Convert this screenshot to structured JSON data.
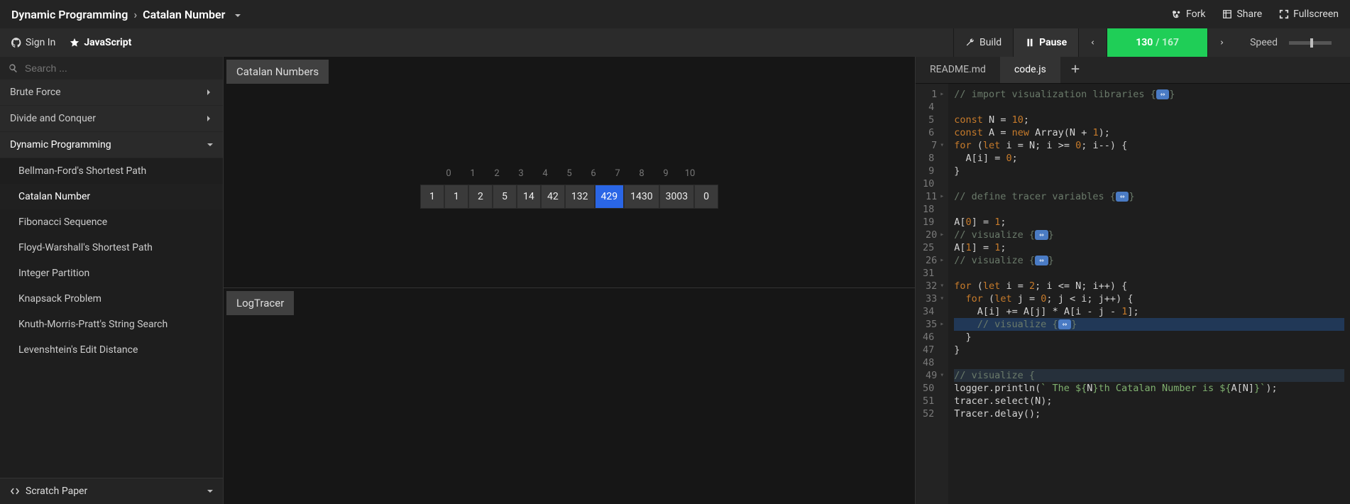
{
  "breadcrumb": {
    "category": "Dynamic Programming",
    "algo": "Catalan Number"
  },
  "topActions": {
    "fork": "Fork",
    "share": "Share",
    "fullscreen": "Fullscreen"
  },
  "auth": {
    "signIn": "Sign In",
    "lang": "JavaScript"
  },
  "controls": {
    "build": "Build",
    "pause": "Pause",
    "step": "130",
    "total": "/ 167",
    "speed": "Speed"
  },
  "search": {
    "placeholder": "Search ..."
  },
  "sidebar": {
    "categories": [
      {
        "name": "Brute Force",
        "expanded": false,
        "items": []
      },
      {
        "name": "Divide and Conquer",
        "expanded": false,
        "items": []
      },
      {
        "name": "Dynamic Programming",
        "expanded": true,
        "items": [
          "Bellman-Ford's Shortest Path",
          "Catalan Number",
          "Fibonacci Sequence",
          "Floyd-Warshall's Shortest Path",
          "Integer Partition",
          "Knapsack Problem",
          "Knuth-Morris-Pratt's String Search",
          "Levenshtein's Edit Distance"
        ],
        "activeIndex": 1
      }
    ],
    "scratch": "Scratch Paper"
  },
  "viz": {
    "title": "Catalan Numbers",
    "indices": [
      "0",
      "1",
      "2",
      "3",
      "4",
      "5",
      "6",
      "7",
      "8",
      "9",
      "10"
    ],
    "values": [
      "1",
      "1",
      "2",
      "5",
      "14",
      "42",
      "132",
      "429",
      "1430",
      "3003",
      "0"
    ],
    "selectedIndex": 7,
    "logTitle": "LogTracer"
  },
  "tabs": {
    "items": [
      "README.md",
      "code.js"
    ],
    "activeIndex": 1
  },
  "code": {
    "lines": [
      {
        "n": "1",
        "fold": "▸",
        "html": "<span class='cmt'>// import visualization libraries {</span><span class='fold-badge'>⇔</span><span class='cmt'>}</span>"
      },
      {
        "n": "4",
        "html": ""
      },
      {
        "n": "5",
        "html": "<span class='kw'>const</span> <span class='id'>N</span> <span class='op'>=</span> <span class='num'>10</span>;"
      },
      {
        "n": "6",
        "html": "<span class='kw'>const</span> <span class='id'>A</span> <span class='op'>=</span> <span class='kw'>new</span> <span class='id'>Array</span>(<span class='id'>N</span> <span class='op'>+</span> <span class='num'>1</span>);"
      },
      {
        "n": "7",
        "fold": "▾",
        "html": "<span class='kw'>for</span> (<span class='kw'>let</span> <span class='id'>i</span> <span class='op'>=</span> <span class='id'>N</span>; <span class='id'>i</span> <span class='op'>&gt;=</span> <span class='num'>0</span>; <span class='id'>i</span><span class='op'>--</span>) {"
      },
      {
        "n": "8",
        "html": "  <span class='id'>A</span>[<span class='id'>i</span>] <span class='op'>=</span> <span class='num'>0</span>;"
      },
      {
        "n": "9",
        "html": "}"
      },
      {
        "n": "10",
        "html": ""
      },
      {
        "n": "11",
        "fold": "▸",
        "html": "<span class='cmt'>// define tracer variables {</span><span class='fold-badge'>⇔</span><span class='cmt'>}</span>"
      },
      {
        "n": "18",
        "html": ""
      },
      {
        "n": "19",
        "html": "<span class='id'>A</span>[<span class='num'>0</span>] <span class='op'>=</span> <span class='num'>1</span>;"
      },
      {
        "n": "20",
        "fold": "▸",
        "html": "<span class='cmt'>// visualize {</span><span class='fold-badge'>⇔</span><span class='cmt'>}</span>"
      },
      {
        "n": "25",
        "html": "<span class='id'>A</span>[<span class='num'>1</span>] <span class='op'>=</span> <span class='num'>1</span>;"
      },
      {
        "n": "26",
        "fold": "▸",
        "html": "<span class='cmt'>// visualize {</span><span class='fold-badge'>⇔</span><span class='cmt'>}</span>"
      },
      {
        "n": "31",
        "html": ""
      },
      {
        "n": "32",
        "fold": "▾",
        "html": "<span class='kw'>for</span> (<span class='kw'>let</span> <span class='id'>i</span> <span class='op'>=</span> <span class='num'>2</span>; <span class='id'>i</span> <span class='op'>&lt;=</span> <span class='id'>N</span>; <span class='id'>i</span><span class='op'>++</span>) {"
      },
      {
        "n": "33",
        "fold": "▾",
        "html": "  <span class='kw'>for</span> (<span class='kw'>let</span> <span class='id'>j</span> <span class='op'>=</span> <span class='num'>0</span>; <span class='id'>j</span> <span class='op'>&lt;</span> <span class='id'>i</span>; <span class='id'>j</span><span class='op'>++</span>) {"
      },
      {
        "n": "34",
        "html": "    <span class='id'>A</span>[<span class='id'>i</span>] <span class='op'>+=</span> <span class='id'>A</span>[<span class='id'>j</span>] <span class='op'>*</span> <span class='id'>A</span>[<span class='id'>i</span> <span class='op'>-</span> <span class='id'>j</span> <span class='op'>-</span> <span class='num'>1</span>];"
      },
      {
        "n": "35",
        "fold": "▸",
        "cls": "hl-line",
        "html": "    <span class='cmt'>// visualize {</span><span class='fold-badge'>⇔</span><span class='cmt'>}</span>"
      },
      {
        "n": "46",
        "html": "  }"
      },
      {
        "n": "47",
        "html": "}"
      },
      {
        "n": "48",
        "html": ""
      },
      {
        "n": "49",
        "fold": "▾",
        "cls": "hl-line-open",
        "html": "<span class='cmt'>// visualize {</span>"
      },
      {
        "n": "50",
        "html": "<span class='id'>logger</span>.<span class='id'>println</span>(<span class='str'>` The ${</span><span class='id'>N</span><span class='str'>}th Catalan Number is ${</span><span class='id'>A</span>[<span class='id'>N</span>]<span class='str'>}`</span>);"
      },
      {
        "n": "51",
        "html": "<span class='id'>tracer</span>.<span class='id'>select</span>(<span class='id'>N</span>);"
      },
      {
        "n": "52",
        "html": "<span class='id'>Tracer</span>.<span class='id'>delay</span>();"
      }
    ]
  }
}
